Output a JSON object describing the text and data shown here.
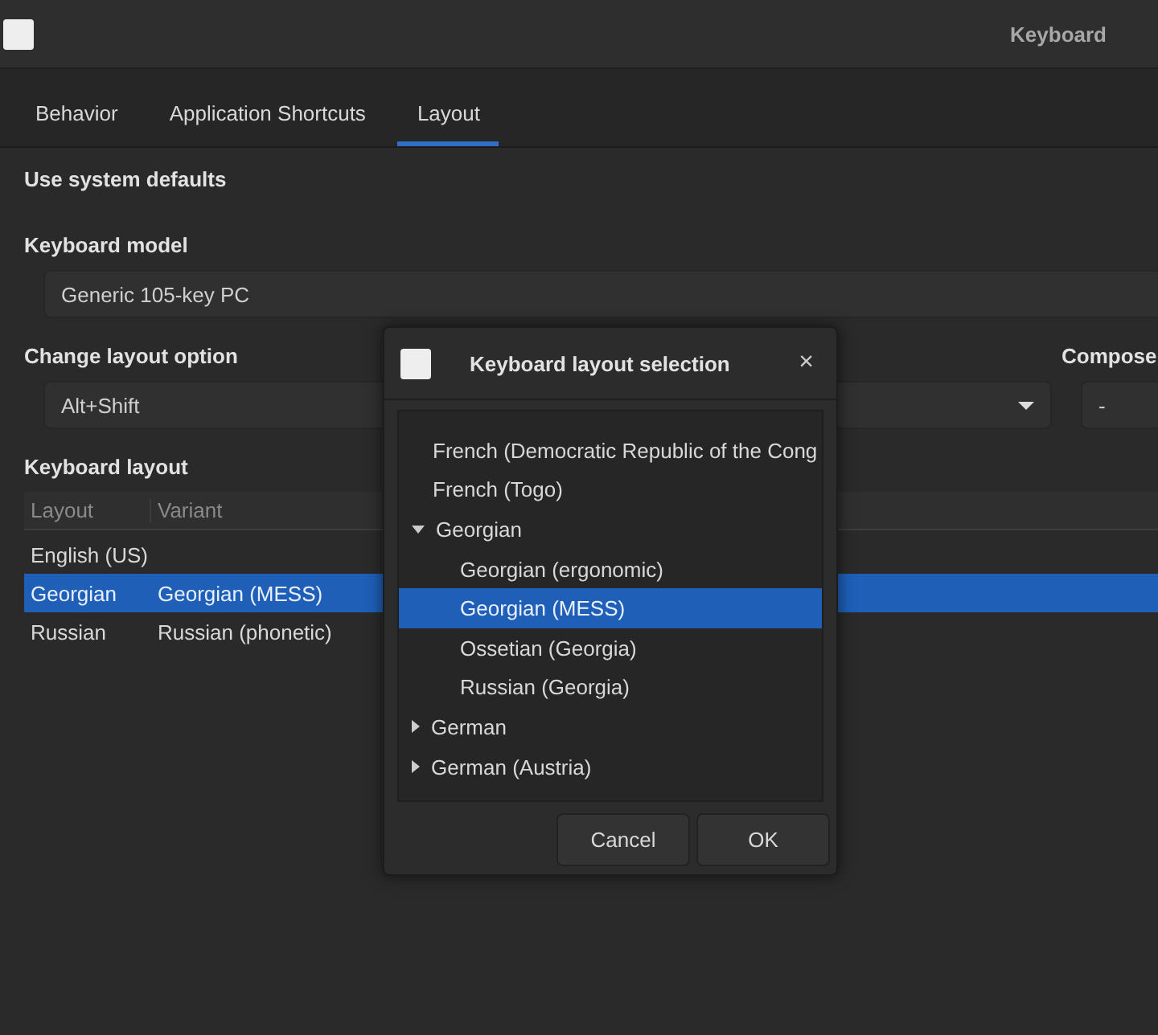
{
  "window": {
    "title": "Keyboard"
  },
  "tabs": [
    {
      "label": "Behavior",
      "selected": false
    },
    {
      "label": "Application Shortcuts",
      "selected": false
    },
    {
      "label": "Layout",
      "selected": true
    }
  ],
  "system_defaults": {
    "label": "Use system defaults"
  },
  "keyboard_model": {
    "label": "Keyboard model",
    "value": "Generic 105-key PC"
  },
  "change_layout_option": {
    "label": "Change layout option",
    "value": "Alt+Shift"
  },
  "compose": {
    "label": "Compose",
    "value": "-"
  },
  "keyboard_layout": {
    "label": "Keyboard layout",
    "columns": [
      "Layout",
      "Variant"
    ],
    "rows": [
      {
        "cells": [
          "English (US)",
          ""
        ],
        "selected": false
      },
      {
        "cells": [
          "Georgian",
          "Georgian (MESS)"
        ],
        "selected": true
      },
      {
        "cells": [
          "Russian",
          "Russian (phonetic)"
        ],
        "selected": false
      }
    ]
  },
  "dialog": {
    "title": "Keyboard layout selection",
    "close": "×",
    "items": [
      {
        "label": "French (Democratic Republic of the Cong",
        "kind": "leaf",
        "selected": false
      },
      {
        "label": "French (Togo)",
        "kind": "leaf",
        "selected": false
      },
      {
        "label": "Georgian",
        "kind": "group",
        "expanded": true,
        "selected": false,
        "children": [
          {
            "label": "Georgian (ergonomic)",
            "selected": false
          },
          {
            "label": "Georgian (MESS)",
            "selected": true
          },
          {
            "label": "Ossetian (Georgia)",
            "selected": false
          },
          {
            "label": "Russian (Georgia)",
            "selected": false
          }
        ]
      },
      {
        "label": "German",
        "kind": "group",
        "expanded": false,
        "selected": false
      },
      {
        "label": "German (Austria)",
        "kind": "group",
        "expanded": false,
        "selected": false
      }
    ],
    "buttons": [
      "Cancel",
      "OK"
    ]
  }
}
